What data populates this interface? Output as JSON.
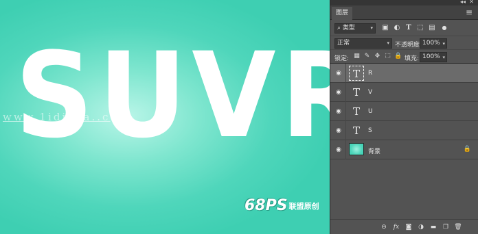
{
  "canvas": {
    "text": "SUVR",
    "watermark": "www.1idi  ..a..c",
    "logo_mark": "68PS",
    "logo_text": "联盟原创"
  },
  "panel": {
    "title": "图层",
    "filter": {
      "value": "类型"
    },
    "blend_mode": "正常",
    "opacity_label": "不透明度:",
    "opacity_value": "100%",
    "lock_label": "锁定:",
    "fill_label": "填充:",
    "fill_value": "100%",
    "layers": [
      {
        "name": "R",
        "kind": "text",
        "visible": true,
        "selected": true
      },
      {
        "name": "V",
        "kind": "text",
        "visible": true,
        "selected": false
      },
      {
        "name": "U",
        "kind": "text",
        "visible": true,
        "selected": false
      },
      {
        "name": "S",
        "kind": "text",
        "visible": true,
        "selected": false
      },
      {
        "name": "背景",
        "kind": "background",
        "visible": true,
        "locked": true
      }
    ],
    "text_thumb_glyph": "T"
  },
  "icons": {
    "eye": "eye-icon",
    "lock": "lock-icon",
    "link": "link-icon",
    "fx": "fx-icon",
    "mask": "mask-icon",
    "adjustment": "adjustment-icon",
    "group": "folder-icon",
    "new_layer": "new-layer-icon",
    "trash": "trash-icon"
  },
  "colors": {
    "canvas_bg": "#3ecfb2",
    "panel_bg": "#535353",
    "selected_row": "#6b6b6b"
  }
}
